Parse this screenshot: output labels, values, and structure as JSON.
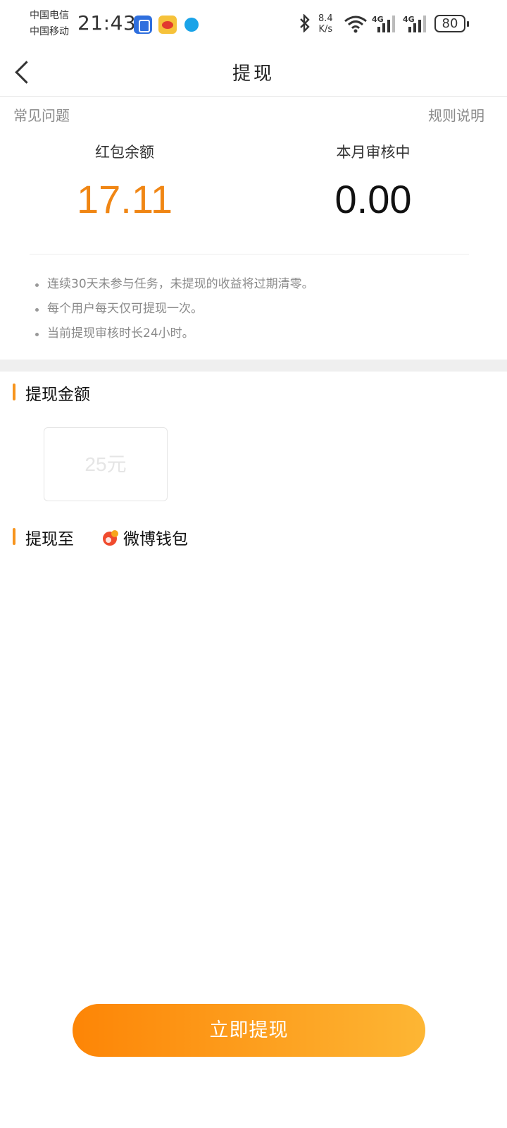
{
  "status_bar": {
    "carrier_1": "中国电信",
    "carrier_2": "中国移动",
    "time": "21:43",
    "net_speed_value": "8.4",
    "net_speed_unit": "K/s",
    "network_1": "4G",
    "network_2": "4G",
    "battery": "80"
  },
  "nav": {
    "title": "提现"
  },
  "links": {
    "faq": "常见问题",
    "rules": "规则说明"
  },
  "stats": {
    "balance_label": "红包余额",
    "balance_value": "17.11",
    "reviewing_label": "本月审核中",
    "reviewing_value": "0.00"
  },
  "notes": [
    "连续30天未参与任务，未提现的收益将过期清零。",
    "每个用户每天仅可提现一次。",
    "当前提现审核时长24小时。"
  ],
  "withdraw_amount": {
    "section_title": "提现金额",
    "options": [
      "25元"
    ]
  },
  "withdraw_to": {
    "section_title": "提现至",
    "wallet_name": "微博钱包"
  },
  "submit": {
    "label": "立即提现"
  },
  "colors": {
    "accent": "#f08614",
    "button_gradient_start": "#fd8506",
    "button_gradient_end": "#fdb634"
  }
}
